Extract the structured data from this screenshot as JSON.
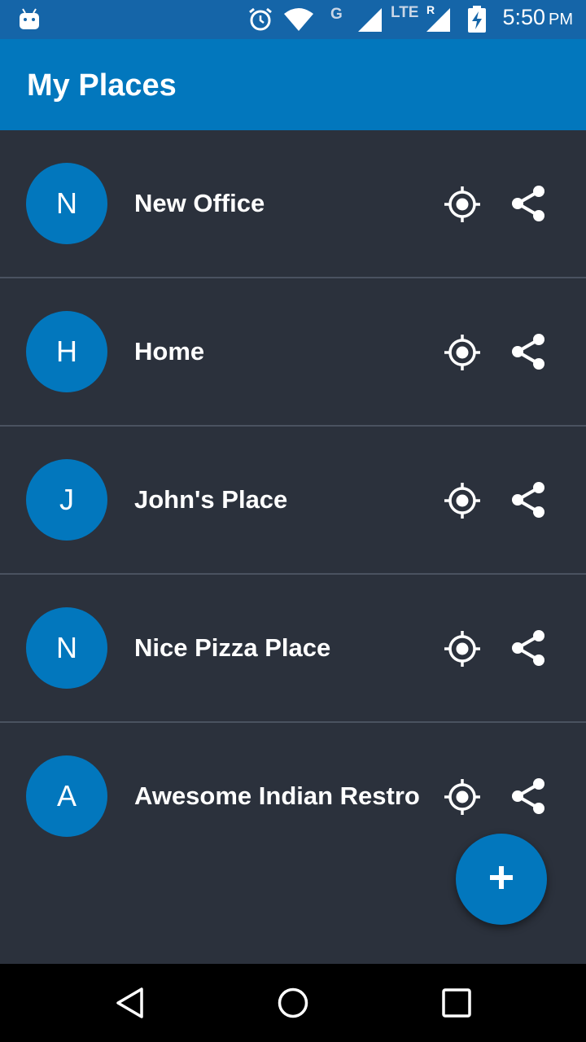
{
  "status_bar": {
    "network_label": "G",
    "lte_label": "LTE",
    "roaming_label": "R",
    "time": "5:50",
    "ampm": "PM",
    "icons": [
      "android-debug-icon",
      "alarm-icon",
      "wifi-icon",
      "signal-icon",
      "signal-roaming-icon",
      "battery-charging-icon"
    ]
  },
  "app_bar": {
    "title": "My Places"
  },
  "places": [
    {
      "initial": "N",
      "name": "New Office"
    },
    {
      "initial": "H",
      "name": "Home"
    },
    {
      "initial": "J",
      "name": "John's Place"
    },
    {
      "initial": "N",
      "name": "Nice Pizza Place"
    },
    {
      "initial": "A",
      "name": "Awesome Indian Restro"
    }
  ],
  "row_icons": [
    "locate-icon",
    "share-icon"
  ],
  "fab": {
    "icon": "plus-icon"
  },
  "nav_bar": {
    "icons": [
      "back-icon",
      "home-icon",
      "recents-icon"
    ]
  },
  "colors": {
    "status_bar": "#1565a8",
    "app_bar": "#0277bd",
    "background": "#2b313c",
    "avatar": "#0277bd",
    "divider": "#4a5260"
  }
}
